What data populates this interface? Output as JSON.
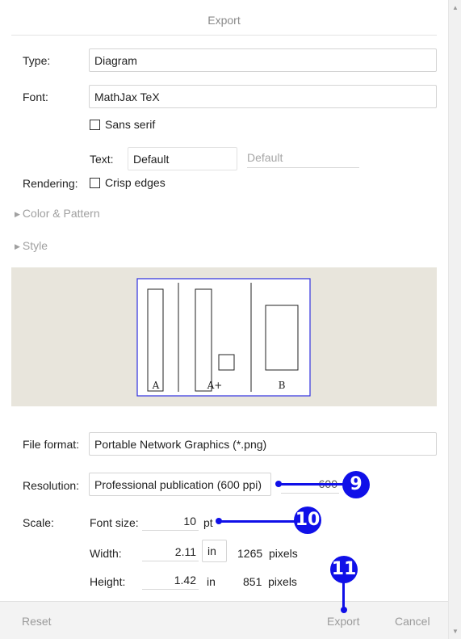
{
  "dialog": {
    "title": "Export",
    "type_label": "Type:",
    "type_value": "Diagram",
    "font_label": "Font:",
    "font_value": "MathJax TeX",
    "sans_serif_label": "Sans serif",
    "text_label": "Text:",
    "text_value": "Default",
    "text_alt_value": "Default",
    "rendering_label": "Rendering:",
    "crisp_edges_label": "Crisp edges",
    "color_pattern_label": "Color & Pattern",
    "style_label": "Style",
    "file_format_label": "File format:",
    "file_format_value": "Portable Network Graphics (*.png)",
    "resolution_label": "Resolution:",
    "resolution_value": "Professional publication (600 ppi)",
    "resolution_ppi": "600",
    "scale_label": "Scale:",
    "font_size_label": "Font size:",
    "font_size_value": "10",
    "font_size_unit": "pt",
    "width_label": "Width:",
    "width_value": "2.11",
    "width_unit": "in",
    "width_pixels": "1265",
    "pixels_label": "pixels",
    "height_label": "Height:",
    "height_value": "1.42",
    "height_unit": "in",
    "height_pixels": "851"
  },
  "preview": {
    "labels": [
      "A",
      "A+",
      "B"
    ]
  },
  "footer": {
    "reset_label": "Reset",
    "export_label": "Export",
    "cancel_label": "Cancel"
  },
  "annotations": {
    "callout_9": "9",
    "callout_10": "10",
    "callout_11": "11",
    "accent_color": "#1010e8"
  }
}
